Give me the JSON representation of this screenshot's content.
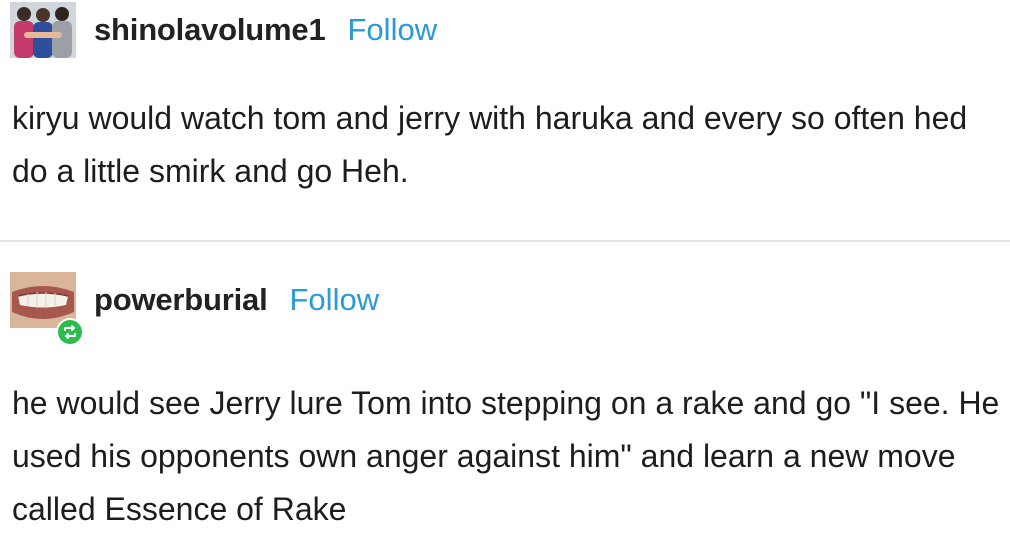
{
  "posts": [
    {
      "username": "shinolavolume1",
      "follow_label": "Follow",
      "avatar_icon": "group-photo-avatar",
      "text": "kiryu would watch tom and jerry with haruka and every so often hed do a little smirk and go Heh."
    },
    {
      "username": "powerburial",
      "follow_label": "Follow",
      "avatar_icon": "smile-photo-avatar",
      "badge_icon": "reblog-icon",
      "text": "he would see Jerry lure Tom into stepping on a rake and go \"I see. He used his opponents own anger against him\" and learn a new move called Essence of Rake"
    }
  ],
  "colors": {
    "follow": "#2a9ad6",
    "reblog_badge": "#2dbd4e",
    "divider": "#e4e4e4"
  }
}
